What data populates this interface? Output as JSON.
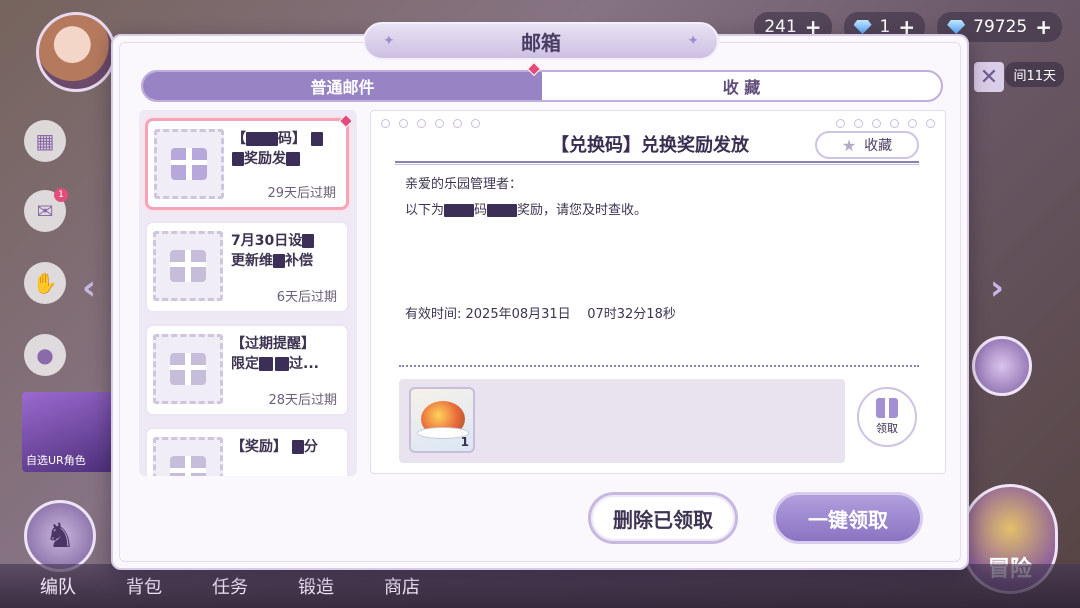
{
  "resources": {
    "stamina": "241",
    "gems_small": "1",
    "diamonds": "79725"
  },
  "side": {
    "mail_badge": "1",
    "promo_text": "自选UR角色",
    "remain_time": "间11天"
  },
  "bottom_nav": [
    "编队",
    "背包",
    "任务",
    "锻造",
    "商店"
  ],
  "adventure_label": "冒险",
  "dialog": {
    "title": "邮箱",
    "tabs": [
      {
        "label": "普通邮件",
        "active": true
      },
      {
        "label": "收 藏",
        "active": false
      }
    ]
  },
  "mails": [
    {
      "title_a": "【",
      "title_b": "码】",
      "title_c": "奖励发",
      "expire": "29天后过期",
      "selected": true
    },
    {
      "title_a": "7月30日设",
      "title_b": "更新维",
      "title_c": "补偿",
      "expire": "6天后过期",
      "selected": false
    },
    {
      "title_a": "【过期提醒】",
      "title_b": "限定",
      "title_c": "过...",
      "expire": "28天后过期",
      "selected": false
    },
    {
      "title_a": "【奖励】",
      "title_b": "分",
      "title_c": "",
      "expire": "",
      "selected": false
    }
  ],
  "detail": {
    "title": "【兑换码】兑换奖励发放",
    "favorite_label": "收藏",
    "greeting": "亲爱的乐园管理者：",
    "body_prefix": "以下为",
    "body_mid": "码",
    "body_suffix": "奖励，请您及时查收。",
    "valid_label": "有效时间: 2025年08月31日",
    "valid_time": "07时32分18秒",
    "reward_count": "1",
    "claim_label": "领取"
  },
  "buttons": {
    "delete_claimed": "删除已领取",
    "claim_all": "一键领取"
  }
}
